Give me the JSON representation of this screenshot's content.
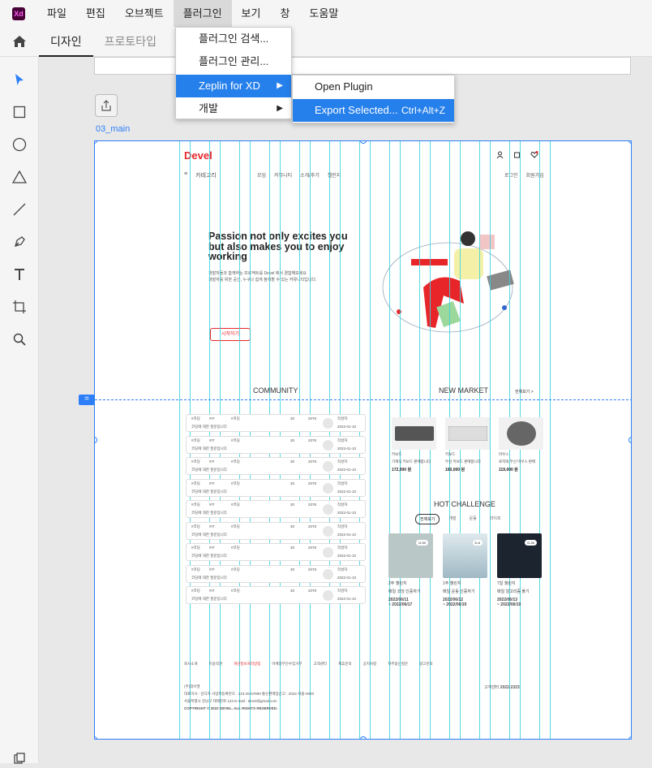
{
  "app": {
    "logo": "Xd",
    "accent": "#2680eb",
    "guide_color": "#35d4e0"
  },
  "menubar": {
    "items": [
      "파일",
      "편집",
      "오브젝트",
      "플러그인",
      "보기",
      "창",
      "도움말"
    ],
    "active": "플러그인"
  },
  "modebar": {
    "tabs": [
      "디자인",
      "프로토타입"
    ],
    "active": "디자인"
  },
  "tools": [
    "select-icon",
    "rectangle-icon",
    "ellipse-icon",
    "polygon-icon",
    "line-icon",
    "pen-icon",
    "text-icon",
    "artboard-icon",
    "zoom-icon"
  ],
  "plugin_menu": {
    "items": [
      {
        "label": "플러그인 검색..."
      },
      {
        "label": "플러그인 관리..."
      },
      {
        "label": "Zeplin for XD",
        "submenu": true,
        "highlighted": true
      },
      {
        "label": "개발",
        "submenu": true
      }
    ]
  },
  "zeplin_submenu": {
    "items": [
      {
        "label": "Open Plugin"
      },
      {
        "label": "Export Selected...",
        "shortcut": "Ctrl+Alt+Z",
        "highlighted": true
      }
    ]
  },
  "artboard": {
    "name": "03_main",
    "header": {
      "logo": "Devel",
      "menu": "카테고리",
      "nav": [
        "모임",
        "커뮤니티",
        "소개/후기",
        "챌린지"
      ],
      "right": [
        "로그인",
        "회원가입"
      ]
    },
    "hero": {
      "title": "Passion not only excites you but also makes you to enjoy working",
      "desc1": "개발자들과 함께하는 프로젝트를 Devel 에서 경험해보세요",
      "desc2": "개발자를 위한 공간, 누구나 쉽게 참여할 수 있는 커뮤니티입니다.",
      "button": "시작하기"
    },
    "community": {
      "title": "COMMUNITY",
      "rows": [
        {
          "tag1": "#코딩",
          "tag2": "#IT",
          "tag3": "#코딩",
          "title": "코딩에 대한 질문입니다",
          "likes": "30",
          "views": "2078",
          "author": "작성자",
          "date": "2022-01-10"
        },
        {
          "tag1": "#코딩",
          "tag2": "#IT",
          "tag3": "#코딩",
          "title": "코딩에 대한 질문입니다",
          "likes": "30",
          "views": "2078",
          "author": "작성자",
          "date": "2022-01-10"
        },
        {
          "tag1": "#코딩",
          "tag2": "#IT",
          "tag3": "#코딩",
          "title": "코딩에 대한 질문입니다",
          "likes": "30",
          "views": "2078",
          "author": "작성자",
          "date": "2022-01-10"
        },
        {
          "tag1": "#코딩",
          "tag2": "#IT",
          "tag3": "#코딩",
          "title": "코딩에 대한 질문입니다",
          "likes": "30",
          "views": "2078",
          "author": "작성자",
          "date": "2022-01-10"
        },
        {
          "tag1": "#코딩",
          "tag2": "#IT",
          "tag3": "#코딩",
          "title": "코딩에 대한 질문입니다",
          "likes": "30",
          "views": "2078",
          "author": "작성자",
          "date": "2022-01-10"
        },
        {
          "tag1": "#코딩",
          "tag2": "#IT",
          "tag3": "#코딩",
          "title": "코딩에 대한 질문입니다",
          "likes": "30",
          "views": "2078",
          "author": "작성자",
          "date": "2022-01-10"
        },
        {
          "tag1": "#코딩",
          "tag2": "#IT",
          "tag3": "#코딩",
          "title": "코딩에 대한 질문입니다",
          "likes": "30",
          "views": "2078",
          "author": "작성자",
          "date": "2022-01-10"
        },
        {
          "tag1": "#코딩",
          "tag2": "#IT",
          "tag3": "#코딩",
          "title": "코딩에 대한 질문입니다",
          "likes": "30",
          "views": "2078",
          "author": "작성자",
          "date": "2022-01-10"
        },
        {
          "tag1": "#코딩",
          "tag2": "#IT",
          "tag3": "#코딩",
          "title": "코딩에 대한 질문입니다",
          "likes": "30",
          "views": "2078",
          "author": "작성자",
          "date": "2022-01-10"
        }
      ]
    },
    "market": {
      "title": "NEW MARKET",
      "more": "전체보기 >",
      "items": [
        {
          "seller": "키보드",
          "name": "기계식 키보드 판매합니다",
          "price": "172,000 원"
        },
        {
          "seller": "키보드",
          "name": "무선 키보드 판매합니다",
          "price": "160,000 원"
        },
        {
          "seller": "마우스",
          "name": "로지텍 무선 마우스 판매",
          "price": "119,000 원"
        }
      ]
    },
    "challenge": {
      "title": "HOT CHALLENGE",
      "tabs": [
        "전체보기",
        "개발",
        "운동",
        "라이프"
      ],
      "cards": [
        {
          "badge": "D-50",
          "name": "2주 챌린지",
          "desc": "매일 코딩 인증하기",
          "period": "2022/06/11\n~ 2022/06/17"
        },
        {
          "badge": "D-6",
          "name": "1주 챌린지",
          "desc": "매일 운동 인증하기",
          "period": "2022/06/12\n~ 2022/06/19"
        },
        {
          "badge": "D-30",
          "name": "7일 챌린지",
          "desc": "매일 알고리즘 풀기",
          "period": "2022/06/13\n~ 2022/06/19"
        }
      ]
    },
    "footer": {
      "links": [
        "회사소개",
        "이용약관",
        "개인정보처리방침",
        "이메일무단수집거부",
        "고객센터",
        "제휴문의",
        "공지사항",
        "자주묻는질문",
        "광고문의"
      ],
      "company": "(주)데브엘",
      "info1": "대표이사 : 김디자  사업자등록번호 : 123-45-67890  통신판매업신고 : 2022-서울-0000",
      "info2": "서울특별시 강남구 테헤란로 123  E-mail : devel@gmail.com",
      "copyright": "COPYRIGHT © 2022 DEVEL. ALL RIGHTS RESERVED.",
      "cs_label": "고객센터",
      "cs_number": "2022-2323"
    }
  }
}
